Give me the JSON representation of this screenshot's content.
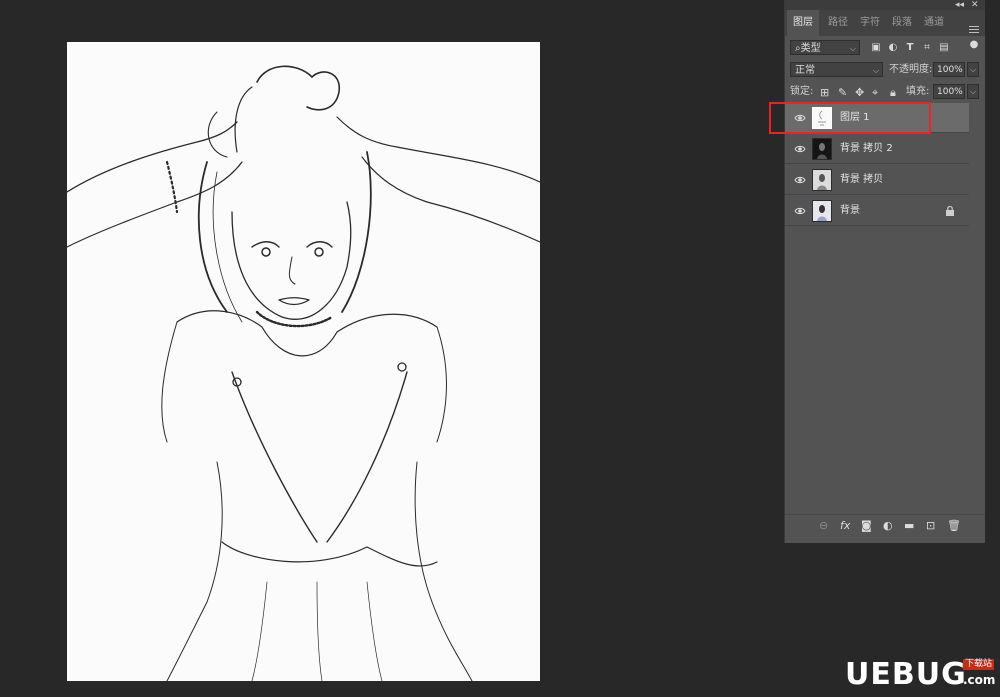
{
  "panel": {
    "topbar": {
      "collapse": "◂◂",
      "close": "✕"
    },
    "tabs": [
      {
        "label": "图层",
        "active": true
      },
      {
        "label": "路径",
        "active": false
      },
      {
        "label": "字符",
        "active": false
      },
      {
        "label": "段落",
        "active": false
      },
      {
        "label": "通道",
        "active": false
      }
    ],
    "filter": {
      "value": "类型",
      "search_icon": "search-icon"
    },
    "blend_mode": "正常",
    "opacity_label": "不透明度:",
    "opacity_value": "100%",
    "lock_label": "锁定:",
    "fill_label": "填充:",
    "fill_value": "100%",
    "layers": [
      {
        "name": "图层 1",
        "selected": true,
        "visible": true,
        "locked": false,
        "thumb": "sketch"
      },
      {
        "name": "背景 拷贝 2",
        "selected": false,
        "visible": true,
        "locked": false,
        "thumb": "dark"
      },
      {
        "name": "背景 拷贝",
        "selected": false,
        "visible": true,
        "locked": false,
        "thumb": "gray"
      },
      {
        "name": "背景",
        "selected": false,
        "visible": true,
        "locked": true,
        "thumb": "color"
      }
    ],
    "bottom_icons": [
      "link-icon",
      "fx-icon",
      "mask-icon",
      "adjustment-icon",
      "folder-icon",
      "new-layer-icon",
      "trash-icon"
    ]
  },
  "watermark": {
    "main": "UEBUG",
    "sub": "下载站",
    "suffix": ".com"
  },
  "colors": {
    "highlight": "#e22222",
    "app_bg": "#282828",
    "panel_bg": "#535353"
  }
}
